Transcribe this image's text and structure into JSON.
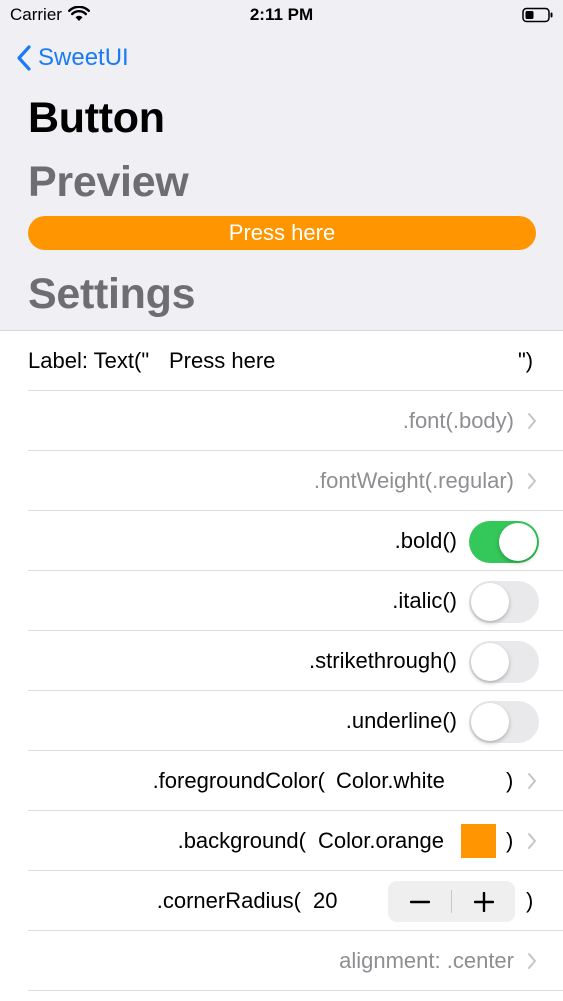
{
  "status": {
    "carrier": "Carrier",
    "time": "2:11 PM"
  },
  "nav": {
    "back_label": "SweetUI"
  },
  "page": {
    "title": "Button"
  },
  "preview": {
    "header": "Preview",
    "button_label": "Press here"
  },
  "settings": {
    "header": "Settings",
    "label_prefix": "Label: Text(\"",
    "label_value": "Press here",
    "label_suffix": "\")",
    "font": ".font(.body)",
    "font_weight": ".fontWeight(.regular)",
    "bold": {
      "label": ".bold()",
      "on": true
    },
    "italic": {
      "label": ".italic()",
      "on": false
    },
    "strikethrough": {
      "label": ".strikethrough()",
      "on": false
    },
    "underline": {
      "label": ".underline()",
      "on": false
    },
    "foreground": {
      "prefix": ".foregroundColor(",
      "value": "Color.white",
      "suffix": ")",
      "color": "#ffffff"
    },
    "background": {
      "prefix": ".background(",
      "value": "Color.orange",
      "suffix": ")",
      "color": "#ff9500"
    },
    "corner_radius": {
      "prefix": ".cornerRadius(",
      "value": "20",
      "suffix": ")",
      "minus": "−",
      "plus": "+"
    },
    "alignment": "alignment: .center"
  },
  "colors": {
    "accent": "#1a7cf5",
    "toggle_on": "#34c759",
    "orange": "#ff9500"
  }
}
